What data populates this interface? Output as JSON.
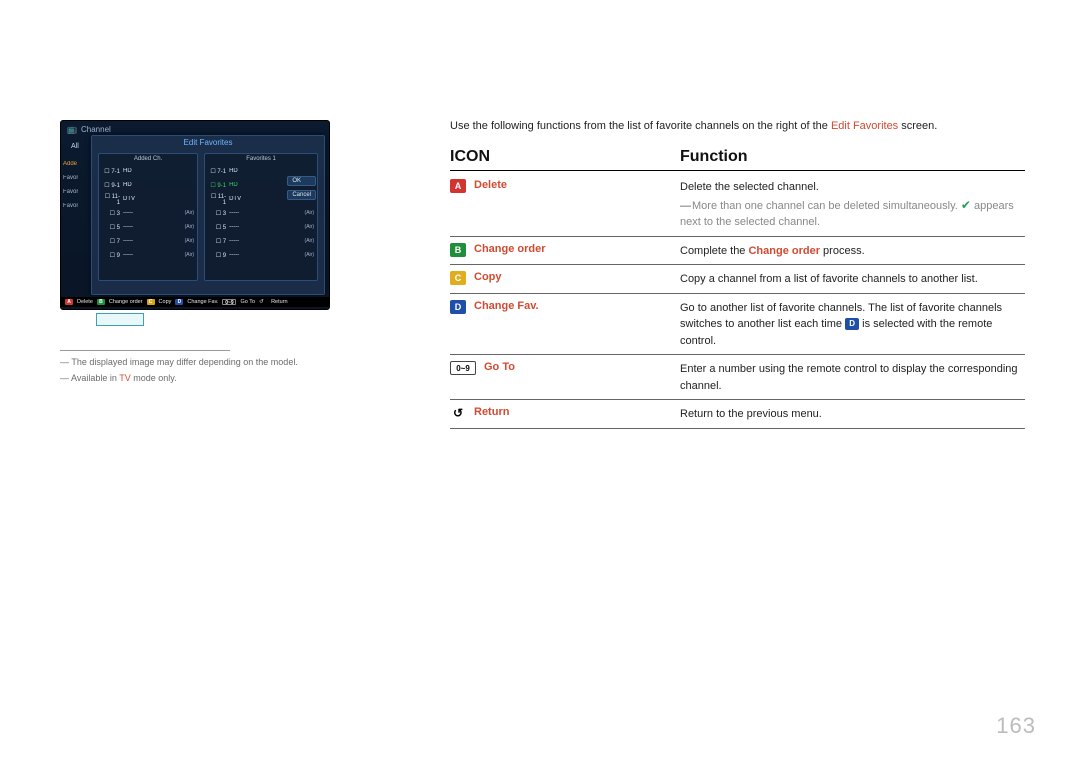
{
  "tv": {
    "screen_title": "Channel",
    "all_label": "All",
    "side_items": [
      "Adde",
      "Favor",
      "Favor",
      "Favor"
    ],
    "modal_title": "Edit Favorites",
    "left_list_title": "Added Ch.",
    "right_list_title": "Favorites 1",
    "rows_left": [
      {
        "num": "7-1",
        "name": "HD",
        "tag": ""
      },
      {
        "num": "9-1",
        "name": "HD",
        "tag": ""
      },
      {
        "num": "11-1",
        "name": "DTV",
        "tag": ""
      },
      {
        "num": "3",
        "name": "-----",
        "tag": "(Air)"
      },
      {
        "num": "5",
        "name": "-----",
        "tag": "(Air)"
      },
      {
        "num": "7",
        "name": "-----",
        "tag": "(Air)"
      },
      {
        "num": "9",
        "name": "-----",
        "tag": "(Air)"
      }
    ],
    "rows_right": [
      {
        "num": "7-1",
        "name": "HD",
        "tag": "",
        "sel": false
      },
      {
        "num": "9-1",
        "name": "HD",
        "tag": "",
        "sel": true
      },
      {
        "num": "11-1",
        "name": "DTV",
        "tag": "",
        "sel": false
      },
      {
        "num": "3",
        "name": "-----",
        "tag": "(Air)",
        "sel": false
      },
      {
        "num": "5",
        "name": "-----",
        "tag": "(Air)",
        "sel": false
      },
      {
        "num": "7",
        "name": "-----",
        "tag": "(Air)",
        "sel": false
      },
      {
        "num": "9",
        "name": "-----",
        "tag": "(Air)",
        "sel": false
      }
    ],
    "ok": "OK",
    "cancel": "Cancel",
    "footer": {
      "a": "Delete",
      "b": "Change order",
      "c": "Copy",
      "d": "Change Fav.",
      "n": "Go To",
      "r": "Return",
      "n_badge": "0~9"
    }
  },
  "footnotes": {
    "f1": "The displayed image may differ depending on the model.",
    "f2_pre": "Available in ",
    "f2_red": "TV",
    "f2_post": " mode only."
  },
  "intro_pre": "Use the following functions from the list of favorite channels on the right of the ",
  "intro_red": "Edit Favorites",
  "intro_post": " screen.",
  "thead": {
    "icon": "ICON",
    "func": "Function"
  },
  "rows": [
    {
      "badge": "A",
      "badge_class": "A",
      "label": "Delete",
      "func_lines": [
        "Delete the selected channel.",
        "__SUB__"
      ],
      "sub_pre": "More than one channel can be deleted simultaneously. ",
      "sub_post": " appears next to the selected channel."
    },
    {
      "badge": "B",
      "badge_class": "B",
      "label": "Change order",
      "func_lines": [
        "Complete the __RED__Change order__/RED__ process."
      ]
    },
    {
      "badge": "C",
      "badge_class": "C",
      "label": "Copy",
      "func_lines": [
        "Copy a channel from a list of favorite channels to another list."
      ]
    },
    {
      "badge": "D",
      "badge_class": "D",
      "label": "Change Fav.",
      "func_lines": [
        "Go to another list of favorite channels. The list of favorite channels switches to another list each time __DBADGE__ is selected with the remote control."
      ]
    },
    {
      "badge": "0~9",
      "badge_class": "k09",
      "label": "Go To",
      "func_lines": [
        "Enter a number using the remote control to display the corresponding channel."
      ]
    },
    {
      "badge": "↺",
      "badge_class": "ret",
      "label": "Return",
      "func_lines": [
        "Return to the previous menu."
      ]
    }
  ],
  "page_number": "163"
}
